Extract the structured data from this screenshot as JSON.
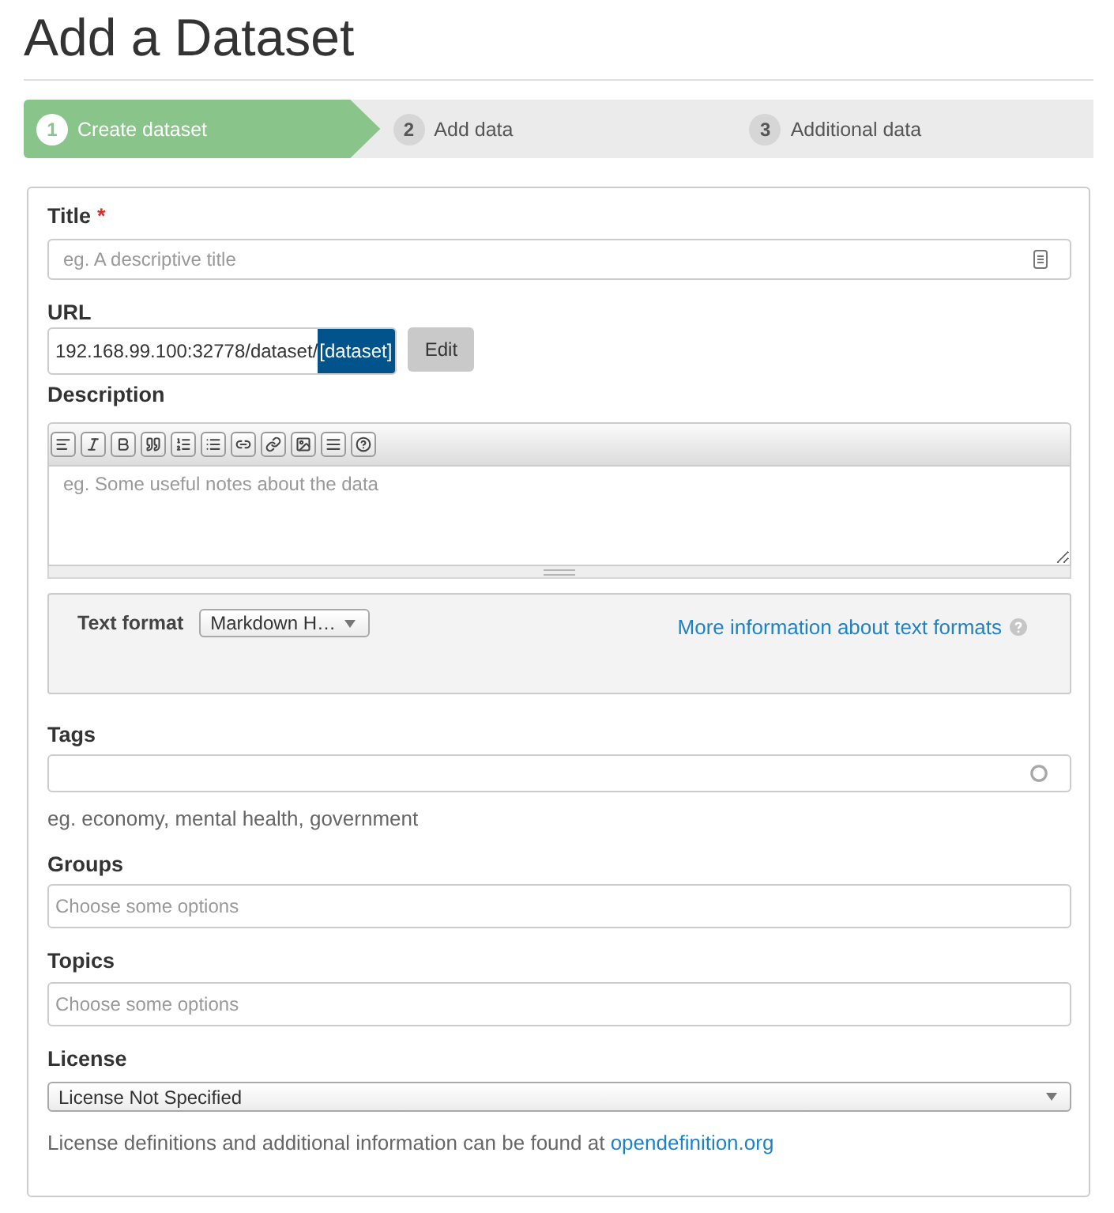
{
  "heading": "Add a Dataset",
  "stages": [
    {
      "number": "1",
      "label": "Create dataset",
      "selected": true
    },
    {
      "number": "2",
      "label": "Add data",
      "selected": false
    },
    {
      "number": "3",
      "label": "Additional data",
      "selected": false
    }
  ],
  "form": {
    "title": {
      "label": "Title",
      "required_mark": "*",
      "placeholder": "eg. A descriptive title"
    },
    "url": {
      "label": "URL",
      "prefix": "192.168.99.100:32778/dataset/",
      "slug": "[dataset]",
      "edit_button": "Edit"
    },
    "description": {
      "label": "Description",
      "placeholder": "eg. Some useful notes about the data"
    },
    "text_format": {
      "label": "Text format",
      "value": "Markdown H…",
      "help_link": "More information about text formats"
    },
    "tags": {
      "label": "Tags",
      "hint": "eg. economy, mental health, government"
    },
    "groups": {
      "label": "Groups",
      "placeholder": "Choose some options"
    },
    "topics": {
      "label": "Topics",
      "placeholder": "Choose some options"
    },
    "license": {
      "label": "License",
      "value": "License Not Specified",
      "help_text": "License definitions and additional information can be found at",
      "help_link": "opendefinition.org"
    }
  }
}
